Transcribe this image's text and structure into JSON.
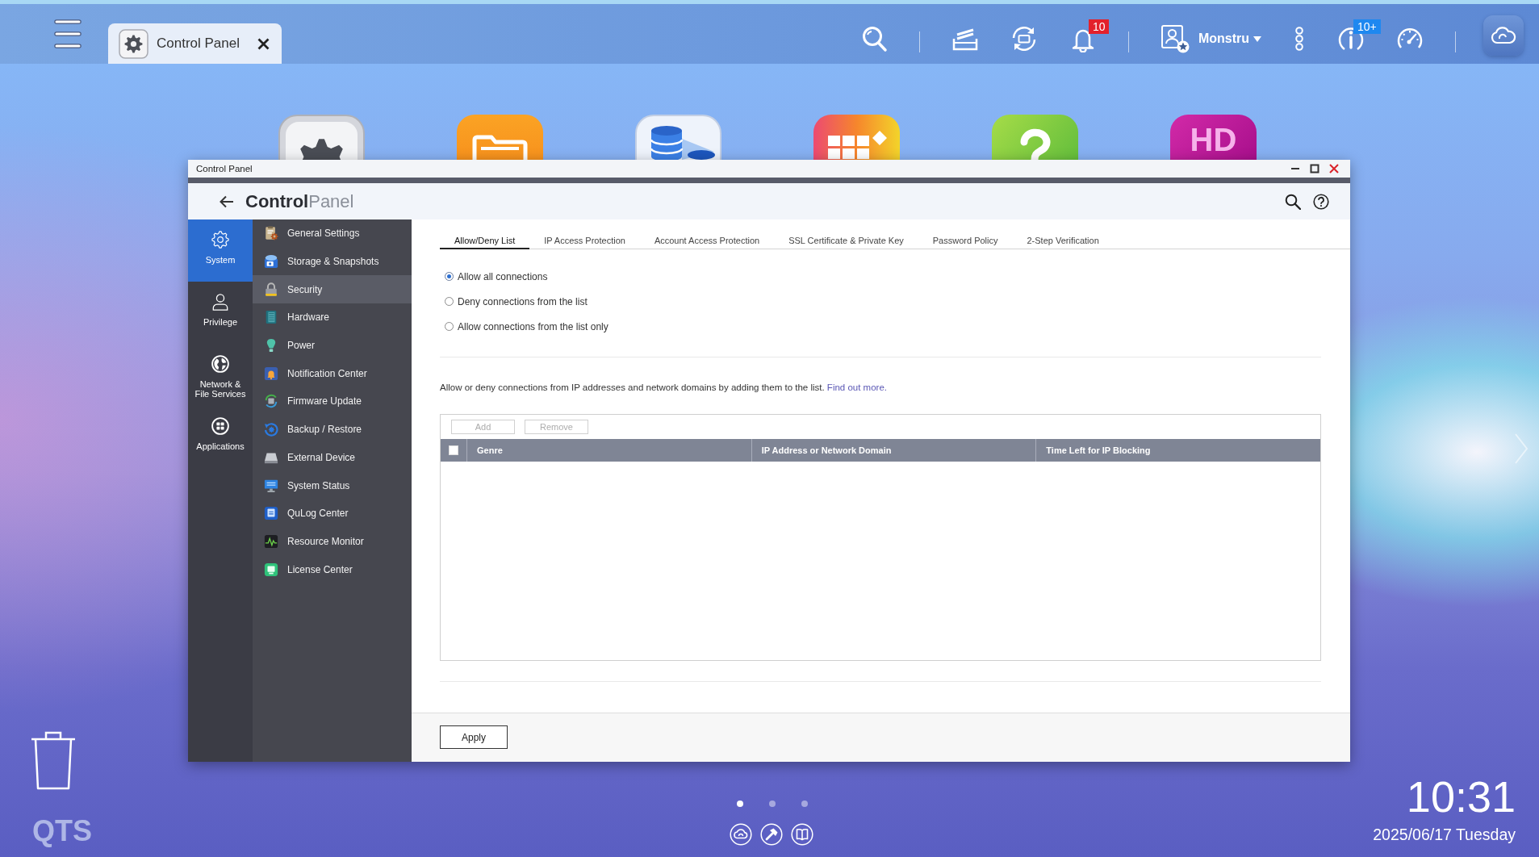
{
  "topbar": {
    "open_apps": [
      {
        "label": "Control Panel",
        "selected": true
      }
    ],
    "notification_count": "10",
    "user": "Monstru",
    "info_count": "10+"
  },
  "desktop": {
    "app_logo_text": "HD",
    "page_dots": [
      {
        "selected": true
      },
      {
        "selected": false
      },
      {
        "selected": false
      }
    ],
    "logo": "QTS",
    "time": "10:31",
    "date": "2025/06/17 Tuesday"
  },
  "window": {
    "title": "Control Panel",
    "app_title": "**Control**Panel",
    "categories": [
      {
        "label": "System",
        "selected": true
      },
      {
        "label": "Privilege",
        "selected": false
      },
      {
        "label": "Network & File Services",
        "selected": false
      },
      {
        "label": "Applications",
        "selected": false
      }
    ],
    "menu": [
      {
        "label": "General Settings",
        "selected": false
      },
      {
        "label": "Storage & Snapshots",
        "selected": false
      },
      {
        "label": "Security",
        "selected": true
      },
      {
        "label": "Hardware",
        "selected": false
      },
      {
        "label": "Power",
        "selected": false
      },
      {
        "label": "Notification Center",
        "selected": false
      },
      {
        "label": "Firmware Update",
        "selected": false
      },
      {
        "label": "Backup / Restore",
        "selected": false
      },
      {
        "label": "External Device",
        "selected": false
      },
      {
        "label": "System Status",
        "selected": false
      },
      {
        "label": "QuLog Center",
        "selected": false
      },
      {
        "label": "Resource Monitor",
        "selected": false
      },
      {
        "label": "License Center",
        "selected": false
      }
    ],
    "tabs": [
      {
        "label": "Allow/Deny List",
        "selected": true
      },
      {
        "label": "IP Access Protection",
        "selected": false
      },
      {
        "label": "Account Access Protection",
        "selected": false
      },
      {
        "label": "SSL Certificate & Private Key",
        "selected": false
      },
      {
        "label": "Password Policy",
        "selected": false
      },
      {
        "label": "2-Step Verification",
        "selected": false
      }
    ],
    "radio_options": [
      {
        "label": "Allow all connections",
        "selected": true
      },
      {
        "label": "Deny connections from the list",
        "selected": false
      },
      {
        "label": "Allow connections from the list only",
        "selected": false
      }
    ],
    "description": "Allow or deny connections from IP addresses and network domains by adding them to the list.",
    "description_link": "Find out more.",
    "table": {
      "buttons": [
        {
          "label": "Add",
          "disabled": true
        },
        {
          "label": "Remove",
          "disabled": true
        }
      ],
      "select_all": {
        "checked": false
      },
      "columns": [
        "Genre",
        "IP Address or Network Domain",
        "Time Left for IP Blocking"
      ]
    },
    "apply_button": "Apply"
  }
}
